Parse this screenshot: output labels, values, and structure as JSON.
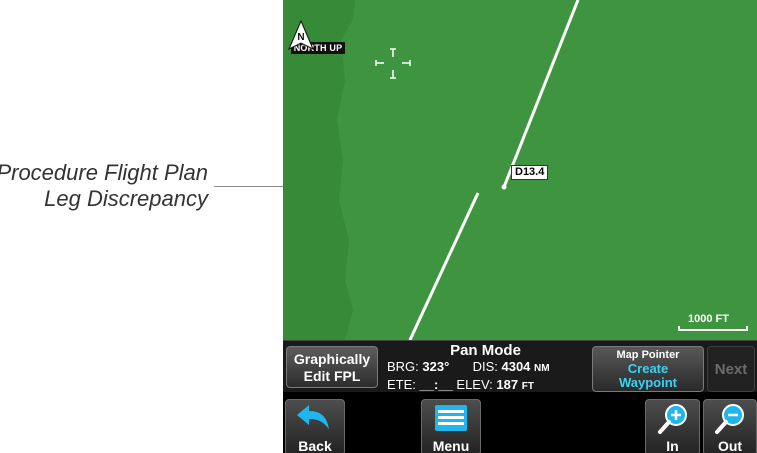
{
  "annotation": {
    "line1": "Procedure Flight Plan",
    "line2": "Leg Discrepancy"
  },
  "map": {
    "north_letter": "N",
    "north_label": "NORTH UP",
    "waypoint_label": "D13.4",
    "scale_label": "1000 FT"
  },
  "pan": {
    "graphically_edit_line1": "Graphically",
    "graphically_edit_line2": "Edit FPL",
    "title": "Pan Mode",
    "brg_label": "BRG:",
    "brg_value": "323°",
    "dis_label": "DIS:",
    "dis_value": "4304",
    "dis_unit": "NM",
    "ete_label": "ETE:",
    "ete_value": "__:__",
    "elev_label": "ELEV:",
    "elev_value": "187",
    "elev_unit": "FT",
    "map_pointer_title": "Map Pointer",
    "map_pointer_action_line1": "Create",
    "map_pointer_action_line2": "Waypoint",
    "next_label": "Next"
  },
  "bottom": {
    "back": "Back",
    "menu": "Menu",
    "zoom_in": "In",
    "zoom_out": "Out"
  },
  "colors": {
    "map_green": "#3f9440",
    "terrain_dark_green": "#378a38",
    "accent_cyan": "#38d4f5",
    "disabled_gray": "#6c6c6c"
  },
  "icons": [
    "north-arrow-icon",
    "crosshair-icon",
    "back-arrow-icon",
    "menu-icon",
    "zoom-in-icon",
    "zoom-out-icon"
  ]
}
